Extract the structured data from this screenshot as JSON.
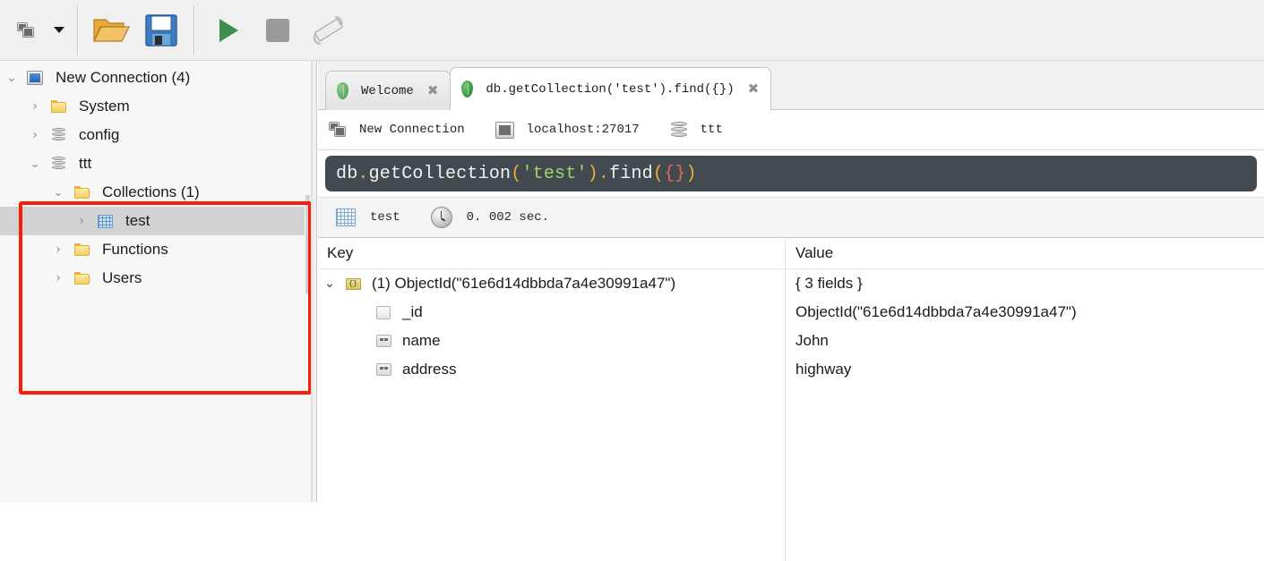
{
  "toolbar": {
    "connect_label": "connect-dropdown",
    "buttons": [
      {
        "name": "connect-button",
        "icon": "computers-icon"
      },
      {
        "name": "connect-dropdown-button",
        "icon": "chevron-down-icon"
      },
      {
        "name": "open-script-button",
        "icon": "folder-open-icon"
      },
      {
        "name": "save-script-button",
        "icon": "floppy-disk-icon"
      },
      {
        "name": "execute-button",
        "icon": "play-icon"
      },
      {
        "name": "stop-button",
        "icon": "stop-icon"
      },
      {
        "name": "toggle-orientation-button",
        "icon": "ruler-icon"
      }
    ]
  },
  "sidebar": {
    "items": [
      {
        "label": "New Connection (4)",
        "icon": "monitor-icon",
        "twist": "⌄",
        "depth": 0,
        "selected": false
      },
      {
        "label": "System",
        "icon": "folder-icon",
        "twist": "›",
        "depth": 1,
        "selected": false
      },
      {
        "label": "config",
        "icon": "database-icon",
        "twist": "›",
        "depth": 1,
        "selected": false
      },
      {
        "label": "ttt",
        "icon": "database-icon",
        "twist": "⌄",
        "depth": 1,
        "selected": false
      },
      {
        "label": "Collections (1)",
        "icon": "folder-icon",
        "twist": "⌄",
        "depth": 2,
        "selected": false
      },
      {
        "label": "test",
        "icon": "collection-icon",
        "twist": "›",
        "depth": 3,
        "selected": true
      },
      {
        "label": "Functions",
        "icon": "folder-icon",
        "twist": "›",
        "depth": 2,
        "selected": false
      },
      {
        "label": "Users",
        "icon": "folder-icon",
        "twist": "›",
        "depth": 2,
        "selected": false
      }
    ],
    "annotation": {
      "name": "red-highlight-box",
      "color": "#fa1d08"
    }
  },
  "tabs": [
    {
      "label": "Welcome",
      "icon": "mongo-leaf-icon",
      "close": "✖",
      "active": false
    },
    {
      "label": "db.getCollection('test').find({})",
      "icon": "mongo-leaf-icon",
      "close": "✖",
      "active": true
    }
  ],
  "connection_bar": {
    "connection": "New Connection",
    "host": "localhost:27017",
    "database": "ttt"
  },
  "query_editor": {
    "full_text": "db.getCollection('test').find({})",
    "tokens": [
      {
        "t": "db",
        "k": "plain"
      },
      {
        "t": ".",
        "k": "op"
      },
      {
        "t": "getCollection",
        "k": "plain"
      },
      {
        "t": "(",
        "k": "paren"
      },
      {
        "t": "'test'",
        "k": "str"
      },
      {
        "t": ")",
        "k": "paren"
      },
      {
        "t": ".",
        "k": "op"
      },
      {
        "t": "find",
        "k": "plain"
      },
      {
        "t": "(",
        "k": "paren"
      },
      {
        "t": "{",
        "k": "brace"
      },
      {
        "t": "}",
        "k": "brace"
      },
      {
        "t": ")",
        "k": "paren"
      }
    ],
    "colors": {
      "background": "#434a4f",
      "plain": "#f2f2f2",
      "operator": "#ecad3f",
      "paren": "#ecad3f",
      "string": "#9fd36b",
      "brace": "#e2685e"
    }
  },
  "result_bar": {
    "collection": "test",
    "elapsed": "0. 002 sec."
  },
  "results": {
    "columns": {
      "key": "Key",
      "value": "Value"
    },
    "rows": [
      {
        "key": "(1) ObjectId(\"61e6d14dbbda7a4e30991a47\")",
        "value": "{ 3 fields }",
        "icon": "document-icon",
        "twist": "⌄",
        "depth": 0
      },
      {
        "key": "_id",
        "value": "ObjectId(\"61e6d14dbbda7a4e30991a47\")",
        "icon": "objectid-icon",
        "twist": "",
        "depth": 1
      },
      {
        "key": "name",
        "value": "John",
        "icon": "string-icon",
        "twist": "",
        "depth": 1
      },
      {
        "key": "address",
        "value": "highway",
        "icon": "string-icon",
        "twist": "",
        "depth": 1
      }
    ]
  }
}
